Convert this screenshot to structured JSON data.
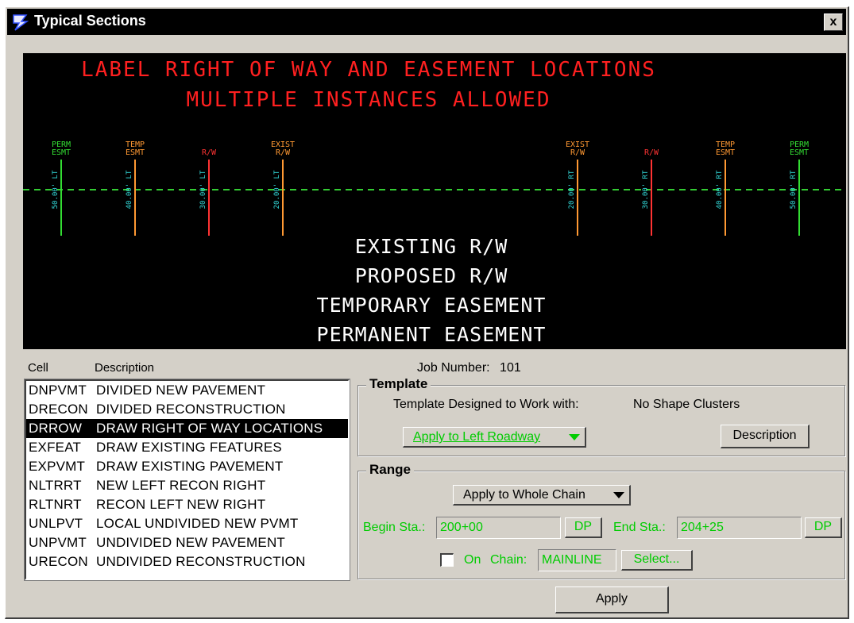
{
  "window": {
    "title": "Typical Sections",
    "close_label": "x"
  },
  "preview": {
    "title_line1": "LABEL RIGHT OF WAY AND EASEMENT LOCATIONS",
    "title_line2": "MULTIPLE INSTANCES ALLOWED",
    "legend_lines": [
      "EXISTING R/W",
      "PROPOSED R/W",
      "TEMPORARY EASEMENT",
      "PERMANENT EASEMENT"
    ],
    "markers": [
      {
        "label1": "PERM",
        "label2": "ESMT",
        "offset": "50.00' LT",
        "color": "#33dd33"
      },
      {
        "label1": "TEMP",
        "label2": "ESMT",
        "offset": "40.00' LT",
        "color": "#ff9933"
      },
      {
        "label1": "R/W",
        "label2": "",
        "offset": "30.00' LT",
        "color": "#ff3333"
      },
      {
        "label1": "EXIST",
        "label2": "R/W",
        "offset": "20.00' LT",
        "color": "#ff9933"
      },
      {
        "label1": "EXIST",
        "label2": "R/W",
        "offset": "20.00' RT",
        "color": "#ff9933"
      },
      {
        "label1": "R/W",
        "label2": "",
        "offset": "30.00' RT",
        "color": "#ff3333"
      },
      {
        "label1": "TEMP",
        "label2": "ESMT",
        "offset": "40.00' RT",
        "color": "#ff9933"
      },
      {
        "label1": "PERM",
        "label2": "ESMT",
        "offset": "50.00' RT",
        "color": "#33dd33"
      }
    ],
    "colors": {
      "title": "#ff2020",
      "legend": "#ffffff",
      "centerline": "#33cc33",
      "offset_text": "#33dddd"
    }
  },
  "list": {
    "header_cell": "Cell",
    "header_description": "Description",
    "selected_index": 2,
    "items": [
      {
        "cell": "DNPVMT",
        "description": "DIVIDED NEW PAVEMENT"
      },
      {
        "cell": "DRECON",
        "description": "DIVIDED RECONSTRUCTION"
      },
      {
        "cell": "DRROW",
        "description": "DRAW RIGHT OF WAY LOCATIONS"
      },
      {
        "cell": "EXFEAT",
        "description": "DRAW EXISTING FEATURES"
      },
      {
        "cell": "EXPVMT",
        "description": "DRAW EXISTING PAVEMENT"
      },
      {
        "cell": "NLTRRT",
        "description": "NEW LEFT RECON RIGHT"
      },
      {
        "cell": "RLTNRT",
        "description": "RECON LEFT NEW RIGHT"
      },
      {
        "cell": "UNLPVT",
        "description": "LOCAL UNDIVIDED NEW PVMT"
      },
      {
        "cell": "UNPVMT",
        "description": "UNDIVIDED NEW PAVEMENT"
      },
      {
        "cell": "URECON",
        "description": "UNDIVIDED RECONSTRUCTION"
      }
    ]
  },
  "job": {
    "label": "Job Number:",
    "value": "101"
  },
  "template": {
    "legend": "Template",
    "designed_label": "Template Designed to Work with:",
    "designed_value": "No Shape Clusters",
    "apply_select": "Apply to Left Roadway",
    "description_button": "Description"
  },
  "range": {
    "legend": "Range",
    "apply_select": "Apply to Whole Chain",
    "begin_label": "Begin Sta.:",
    "begin_value": "200+00",
    "begin_dp": "DP",
    "end_label": "End Sta.:",
    "end_value": "204+25",
    "end_dp": "DP",
    "on_label": "On",
    "chain_label": "Chain:",
    "chain_value": "MAINLINE",
    "select_button": "Select..."
  },
  "apply_button": "Apply"
}
